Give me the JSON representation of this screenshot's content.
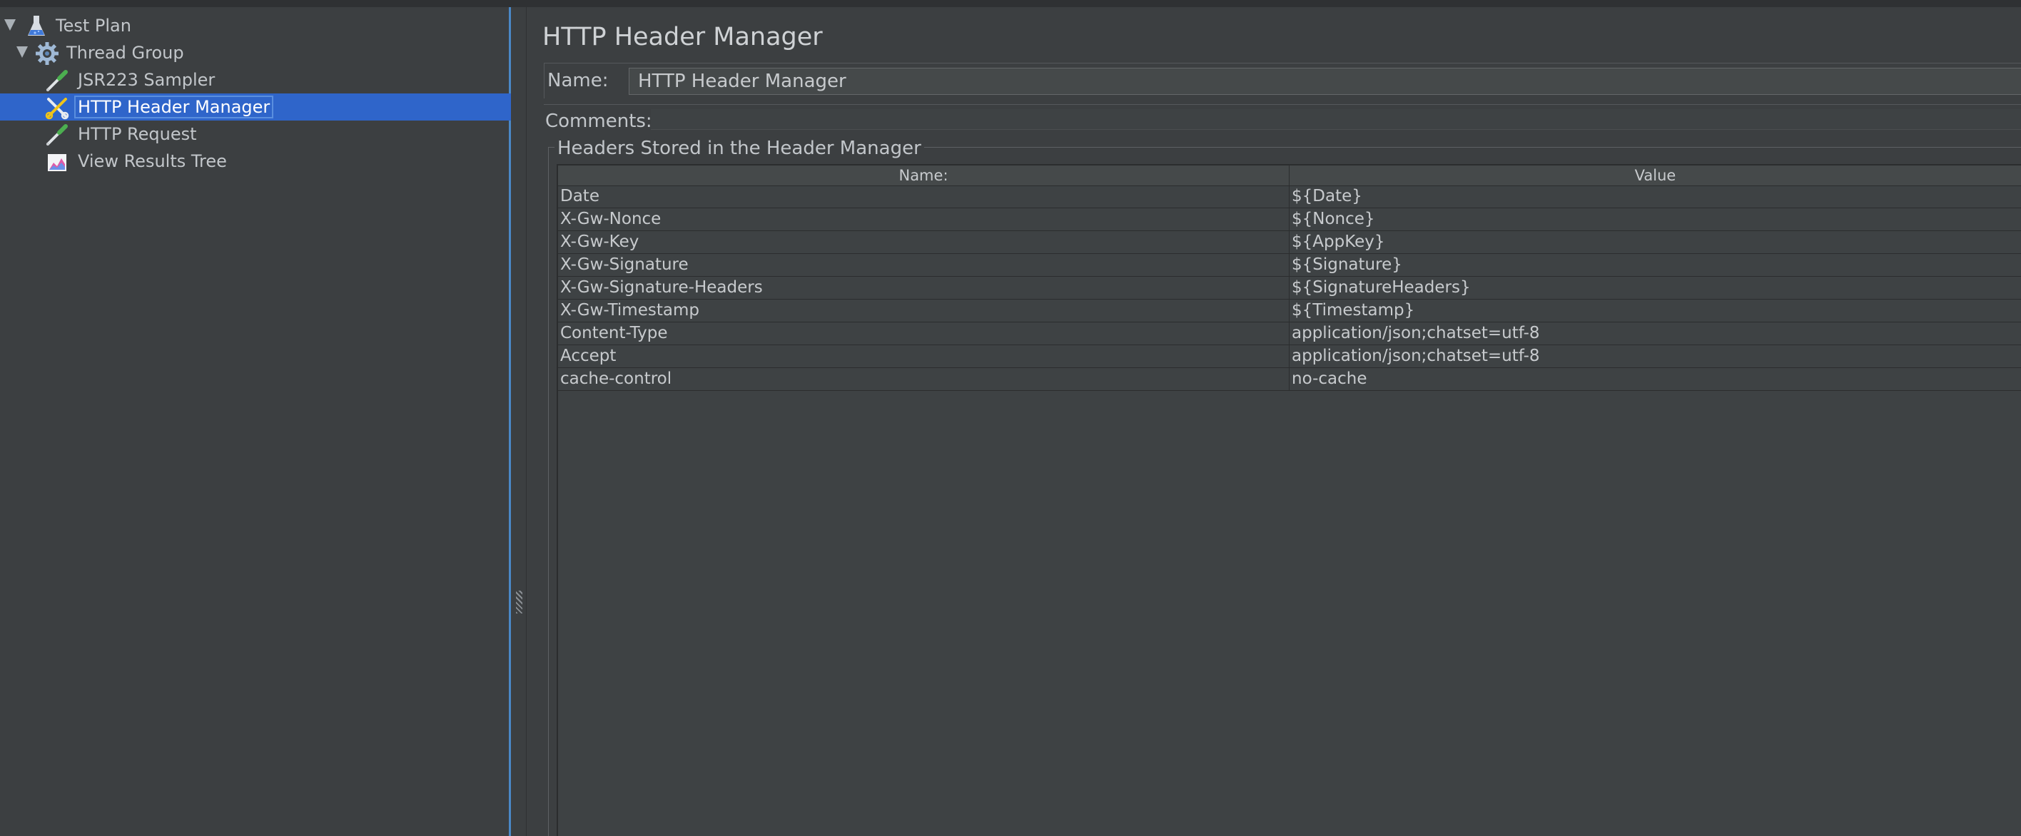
{
  "tree": {
    "items": [
      {
        "label": "Test Plan",
        "icon": "flask-icon"
      },
      {
        "label": "Thread Group",
        "icon": "gear-icon"
      },
      {
        "label": "JSR223 Sampler",
        "icon": "pipette-icon"
      },
      {
        "label": "HTTP Header Manager",
        "icon": "scissors-icon",
        "selected": true
      },
      {
        "label": "HTTP Request",
        "icon": "pipette-icon"
      },
      {
        "label": "View Results Tree",
        "icon": "chart-icon"
      }
    ]
  },
  "panel": {
    "title": "HTTP Header Manager",
    "name_label": "Name:",
    "name_value": "HTTP Header Manager",
    "comments_label": "Comments:",
    "group_title": "Headers Stored in the Header Manager"
  },
  "table": {
    "columns": [
      "Name:",
      "Value"
    ],
    "rows": [
      [
        "Date",
        "${Date}"
      ],
      [
        "X-Gw-Nonce",
        "${Nonce}"
      ],
      [
        "X-Gw-Key",
        "${AppKey}"
      ],
      [
        "X-Gw-Signature",
        "${Signature}"
      ],
      [
        "X-Gw-Signature-Headers",
        "${SignatureHeaders}"
      ],
      [
        "X-Gw-Timestamp",
        "${Timestamp}"
      ],
      [
        "Content-Type",
        "application/json;chatset=utf-8"
      ],
      [
        "Accept",
        "application/json;chatset=utf-8"
      ],
      [
        "cache-control",
        "no-cache"
      ]
    ]
  },
  "colors": {
    "background": "#3c3f41",
    "selection": "#2f65ca",
    "text": "#c2c6ca"
  }
}
